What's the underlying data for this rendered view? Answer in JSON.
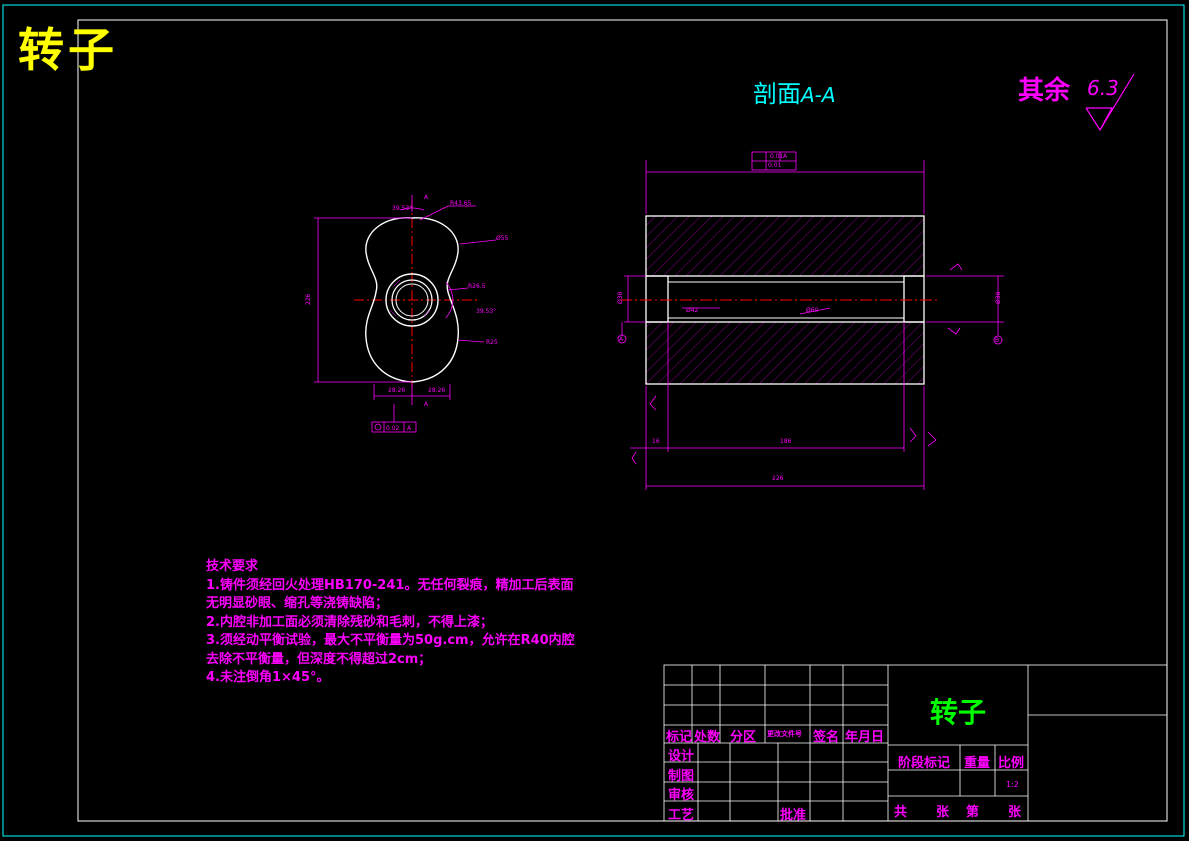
{
  "drawing": {
    "corner_title": "转子",
    "section_title_prefix": "剖面",
    "section_title_suffix": "A-A",
    "roughness_label": "其余",
    "roughness_value": "6.3"
  },
  "notes": {
    "heading": "技术要求",
    "lines": [
      "1.铸件须经回火处理HB170-241。无任何裂痕，精加工后表面",
      "无明显砂眼、缩孔等浇铸缺陷；",
      "2.内腔非加工面必须清除残砂和毛刺，不得上漆；",
      "3.须经动平衡试验，最大不平衡量为50g.cm，允许在R40内腔",
      "去除不平衡量，但深度不得超过2cm；",
      "4.未注倒角1×45°。"
    ]
  },
  "title_block": {
    "part_name": "转子",
    "hdr_mark": "标记",
    "hdr_count": "处数",
    "hdr_zone": "分区",
    "hdr_docno": "更改文件号",
    "hdr_sign": "签名",
    "hdr_date": "年月日",
    "design": "设计",
    "drawing_by": "制图",
    "review": "审核",
    "process": "工艺",
    "approve": "批准",
    "stage": "阶段标记",
    "weight": "重量",
    "scale": "比例",
    "scale_value": "1:2",
    "total": "共",
    "sheets": "张",
    "sheet_no": "第",
    "sheets2": "张"
  },
  "dims": {
    "length_total": "226",
    "length_inner": "186",
    "left_step": "16",
    "width_left": "28.26",
    "width_right": "28.26",
    "angle_top": "39.53°",
    "angle_side": "39.53°",
    "radius_top": "R43.65",
    "bore": "Ø55",
    "tol_frame": "0.02",
    "datum": "A"
  },
  "colors": {
    "frame": "#00ffff",
    "outline": "#ffffff",
    "dimension": "#ff00ff",
    "center": "#ff0000",
    "title_yellow": "#ffff00",
    "title_green": "#00ff00"
  }
}
